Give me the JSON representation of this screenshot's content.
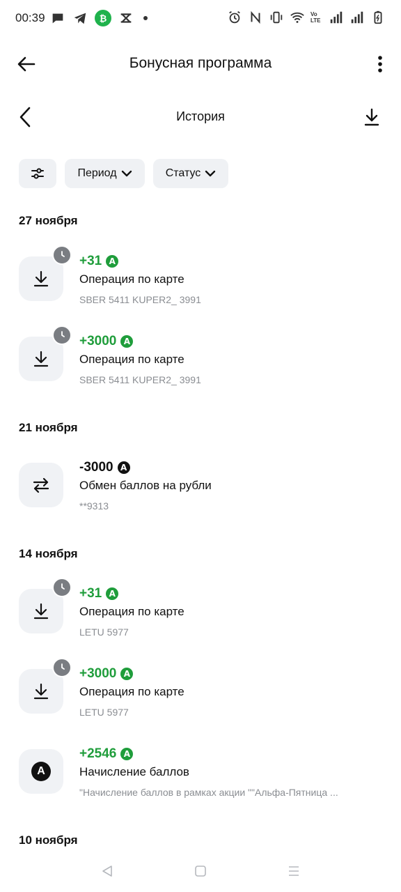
{
  "status_bar": {
    "time": "00:39",
    "left_icons": [
      "chat-icon",
      "telegram-icon",
      "app-green-icon",
      "capcut-icon",
      "dot"
    ],
    "right_icons": [
      "alarm-icon",
      "nfc-icon",
      "vibrate-icon",
      "wifi-icon",
      "volte-icon",
      "signal-icon",
      "signal-icon",
      "battery-icon"
    ],
    "volte_text": "Vo LTE"
  },
  "app_bar": {
    "title": "Бонусная программа"
  },
  "sub_bar": {
    "title": "История"
  },
  "filters": {
    "period_label": "Период",
    "status_label": "Статус"
  },
  "colors": {
    "positive": "#1f9d3b",
    "tile_bg": "#f0f2f5",
    "chip_bg": "#eff1f4",
    "muted_text": "#8a8d92"
  },
  "groups": [
    {
      "date": "27 ноября",
      "items": [
        {
          "amount": "+31",
          "title": "Операция по карте",
          "subtitle": "SBER 5411 KUPER2_ 3991",
          "icon": "download-icon",
          "pending": true
        },
        {
          "amount": "+3000",
          "title": "Операция по карте",
          "subtitle": "SBER 5411 KUPER2_ 3991",
          "icon": "download-icon",
          "pending": true
        }
      ]
    },
    {
      "date": "21 ноября",
      "items": [
        {
          "amount": "-3000",
          "title": "Обмен баллов на рубли",
          "subtitle": "**9313",
          "icon": "exchange-icon",
          "pending": false
        }
      ]
    },
    {
      "date": "14 ноября",
      "items": [
        {
          "amount": "+31",
          "title": "Операция по карте",
          "subtitle": "LETU 5977",
          "icon": "download-icon",
          "pending": true
        },
        {
          "amount": "+3000",
          "title": "Операция по карте",
          "subtitle": "LETU 5977",
          "icon": "download-icon",
          "pending": true
        },
        {
          "amount": "+2546",
          "title": "Начисление баллов",
          "subtitle": "\"Начисление баллов в рамках акции \"\"Альфа-Пятница ...",
          "icon": "alfa-icon",
          "pending": false
        }
      ]
    },
    {
      "date": "10 ноября",
      "items": []
    }
  ],
  "coin_letter": "A",
  "nav_bar": [
    "back-icon",
    "home-icon",
    "recents-icon"
  ]
}
